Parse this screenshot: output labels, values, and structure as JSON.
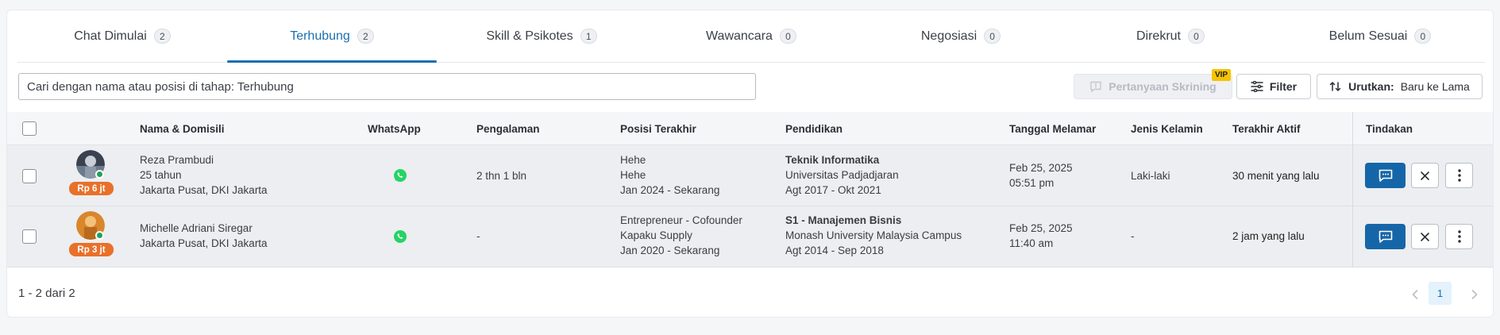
{
  "tabs": [
    {
      "label": "Chat Dimulai",
      "count": "2"
    },
    {
      "label": "Terhubung",
      "count": "2"
    },
    {
      "label": "Skill & Psikotes",
      "count": "1"
    },
    {
      "label": "Wawancara",
      "count": "0"
    },
    {
      "label": "Negosiasi",
      "count": "0"
    },
    {
      "label": "Direkrut",
      "count": "0"
    },
    {
      "label": "Belum Sesuai",
      "count": "0"
    }
  ],
  "active_tab": "Terhubung",
  "toolbar": {
    "search_placeholder": "Cari dengan nama atau posisi di tahap: Terhubung",
    "screening_label": "Pertanyaan Skrining",
    "vip_badge": "VIP",
    "filter_label": "Filter",
    "sort_label": "Urutkan:",
    "sort_value": "Baru ke Lama"
  },
  "table": {
    "headers": {
      "name": "Nama & Domisili",
      "whatsapp": "WhatsApp",
      "experience": "Pengalaman",
      "last_position": "Posisi Terakhir",
      "education": "Pendidikan",
      "applied_date": "Tanggal Melamar",
      "gender": "Jenis Kelamin",
      "last_active": "Terakhir Aktif",
      "actions": "Tindakan"
    },
    "rows": [
      {
        "salary": "Rp 6 jt",
        "name": "Reza Prambudi",
        "age": "25 tahun",
        "location": "Jakarta Pusat, DKI Jakarta",
        "experience": "2 thn 1 bln",
        "position_title": "Hehe",
        "position_company": "Hehe",
        "position_period": "Jan 2024 - Sekarang",
        "edu_major": "Teknik Informatika",
        "edu_school": "Universitas Padjadjaran",
        "edu_period": "Agt 2017 - Okt 2021",
        "applied_date": "Feb 25, 2025",
        "applied_time": "05:51 pm",
        "gender": "Laki-laki",
        "last_active": "30 menit yang lalu"
      },
      {
        "salary": "Rp 3 jt",
        "name": "Michelle Adriani Siregar",
        "location": "Jakarta Pusat, DKI Jakarta",
        "experience": "-",
        "position_title": "Entrepreneur - Cofounder",
        "position_company": "Kapaku Supply",
        "position_period": "Jan 2020 - Sekarang",
        "edu_major": "S1 - Manajemen Bisnis",
        "edu_school": "Monash University Malaysia Campus",
        "edu_period": "Agt 2014 - Sep 2018",
        "applied_date": "Feb 25, 2025",
        "applied_time": "11:40 am",
        "gender": "-",
        "last_active": "2 jam yang lalu"
      }
    ]
  },
  "pagination": {
    "range_text": "1 - 2 dari 2",
    "current_page": "1"
  },
  "colors": {
    "accent": "#1a6fb0",
    "salary_badge": "#e8702a",
    "online": "#22a05a",
    "whatsapp": "#25d366",
    "vip": "#f6c400"
  },
  "icons": [
    "message-icon",
    "filter-icon",
    "sort-icon",
    "whatsapp-icon",
    "close-icon",
    "more-vertical-icon",
    "chevron-left-icon",
    "chevron-right-icon"
  ]
}
